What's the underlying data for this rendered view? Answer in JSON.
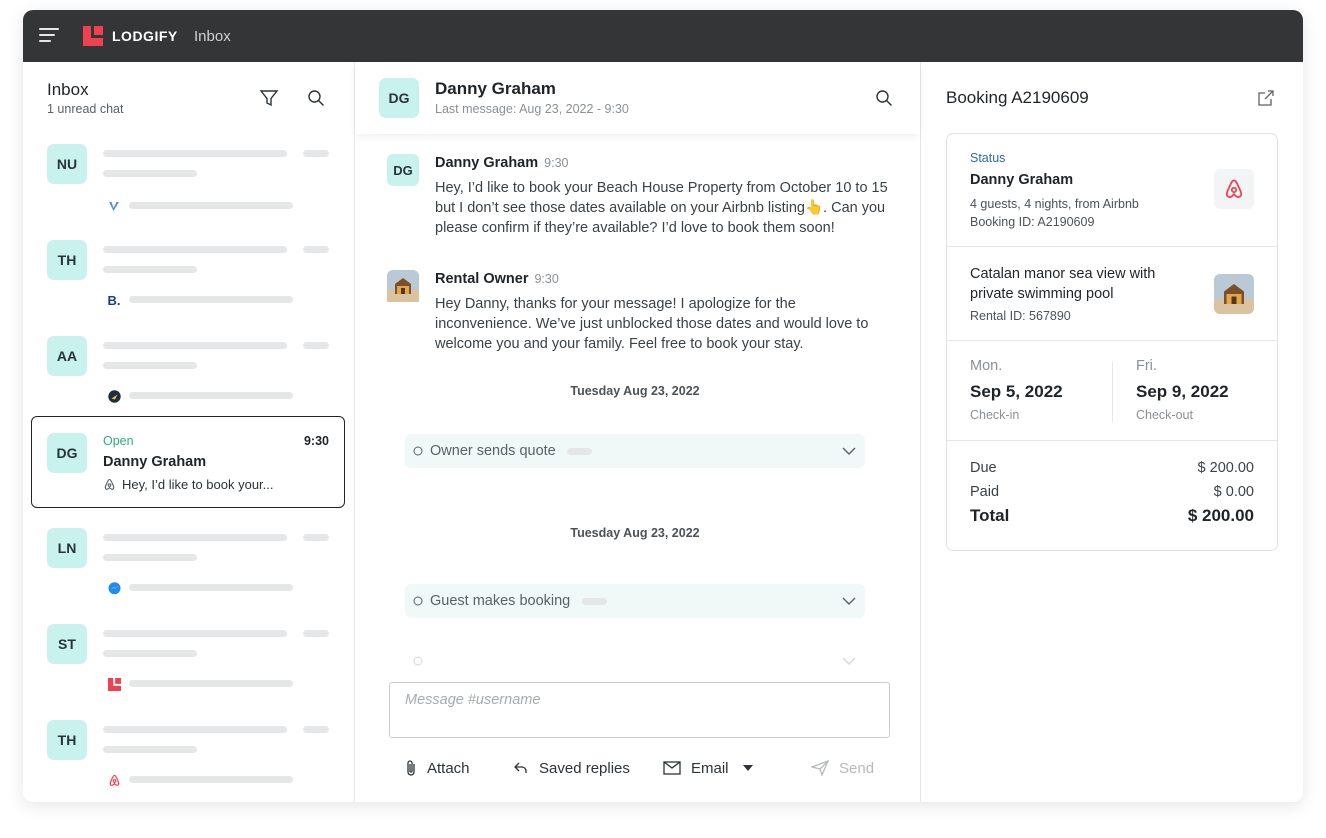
{
  "topbar": {
    "brand": "LODGIFY",
    "title": "Inbox"
  },
  "inbox": {
    "title": "Inbox",
    "subtitle": "1 unread chat",
    "conversations": [
      {
        "initials": "NU",
        "source_icon": "vrbo-icon"
      },
      {
        "initials": "TH",
        "source_icon": "booking-icon",
        "source_glyph": "B."
      },
      {
        "initials": "AA",
        "source_icon": "expedia-icon"
      },
      {
        "initials": "DG",
        "status": "Open",
        "time": "9:30",
        "name": "Danny Graham",
        "preview": "Hey, I’d like to book your...",
        "source_icon": "airbnb-icon"
      },
      {
        "initials": "LN",
        "source_icon": "messenger-icon"
      },
      {
        "initials": "ST",
        "source_icon": "lodgify-icon"
      },
      {
        "initials": "TH",
        "source_icon": "airbnb-icon"
      }
    ]
  },
  "chat": {
    "header": {
      "initials": "DG",
      "name": "Danny Graham",
      "last_message": "Last message: Aug 23, 2022 - 9:30"
    },
    "messages": [
      {
        "initials": "DG",
        "name": "Danny Graham",
        "time": "9:30",
        "text": "Hey, I’d like to book your Beach House Property from October 10 to 15 but I don’t see those dates available on your Airbnb listing👆. Can you please confirm if they’re available? I’d love to book them soon!"
      },
      {
        "name": "Rental Owner",
        "time": "9:30",
        "text": "Hey Danny, thanks for your message! I apologize for the inconvenience. We’ve just unblocked those dates and would love to welcome you and your family. Feel free to book your stay."
      }
    ],
    "separators": [
      "Tuesday Aug 23, 2022",
      "Tuesday Aug 23, 2022"
    ],
    "events": [
      "Owner sends quote",
      "Guest makes booking"
    ],
    "compose_placeholder": "Message #username",
    "toolbar": {
      "attach": "Attach",
      "saved_replies": "Saved replies",
      "email": "Email",
      "send": "Send"
    }
  },
  "booking": {
    "title": "Booking A2190609",
    "status_label": "Status",
    "guest_name": "Danny Graham",
    "guest_details": "4 guests, 4 nights, from Airbnb",
    "booking_id": "Booking ID: A2190609",
    "rental_name": "Catalan manor sea view with private swimming pool",
    "rental_id": "Rental ID: 567890",
    "checkin": {
      "day": "Mon.",
      "date": "Sep 5, 2022",
      "caption": "Check-in"
    },
    "checkout": {
      "day": "Fri.",
      "date": "Sep 9, 2022",
      "caption": "Check-out"
    },
    "payments": [
      {
        "label": "Due",
        "amount": "$ 200.00"
      },
      {
        "label": "Paid",
        "amount": "$ 0.00"
      },
      {
        "label": "Total",
        "amount": "$ 200.00"
      }
    ]
  },
  "colors": {
    "topbar": "#333536",
    "avatar_bg": "#c7f2ee",
    "brand_red": "#f0414f",
    "open_green": "#2eab7e",
    "status_blue": "#2f6ca8",
    "event_bg": "#f0f9f7"
  }
}
